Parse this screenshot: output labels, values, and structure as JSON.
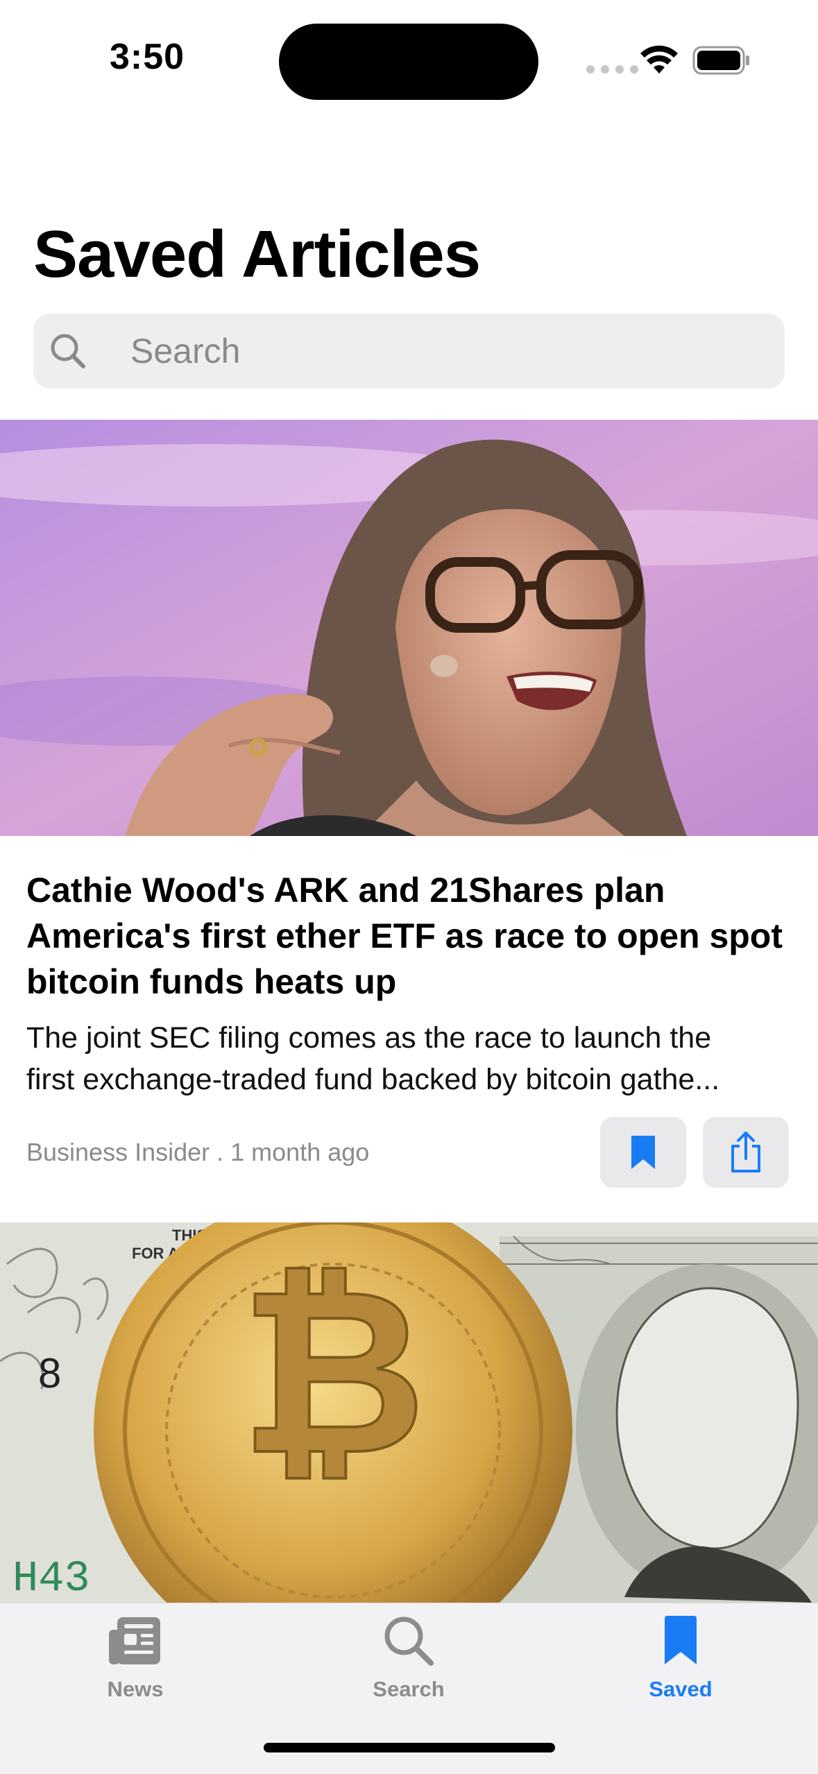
{
  "status_bar": {
    "time": "3:50"
  },
  "header": {
    "title": "Saved Articles"
  },
  "search": {
    "placeholder": "Search"
  },
  "articles": [
    {
      "title": "Cathie Wood's ARK and 21Shares plan America's first ether ETF as race to open spot bitcoin funds heats up",
      "description_line1": "The joint SEC filing comes as the race to launch the",
      "description_line2": "first exchange-traded fund backed by bitcoin gathe...",
      "meta": "Business Insider . 1 month ago"
    }
  ],
  "tab_bar": {
    "items": [
      {
        "label": "News",
        "icon": "newspaper-icon"
      },
      {
        "label": "Search",
        "icon": "search-icon"
      },
      {
        "label": "Saved",
        "icon": "bookmark-icon",
        "active": true
      }
    ]
  },
  "colors": {
    "accent": "#1a7cf5",
    "inactive_tab": "#8c8c8f",
    "search_bg": "#eeeeef"
  }
}
